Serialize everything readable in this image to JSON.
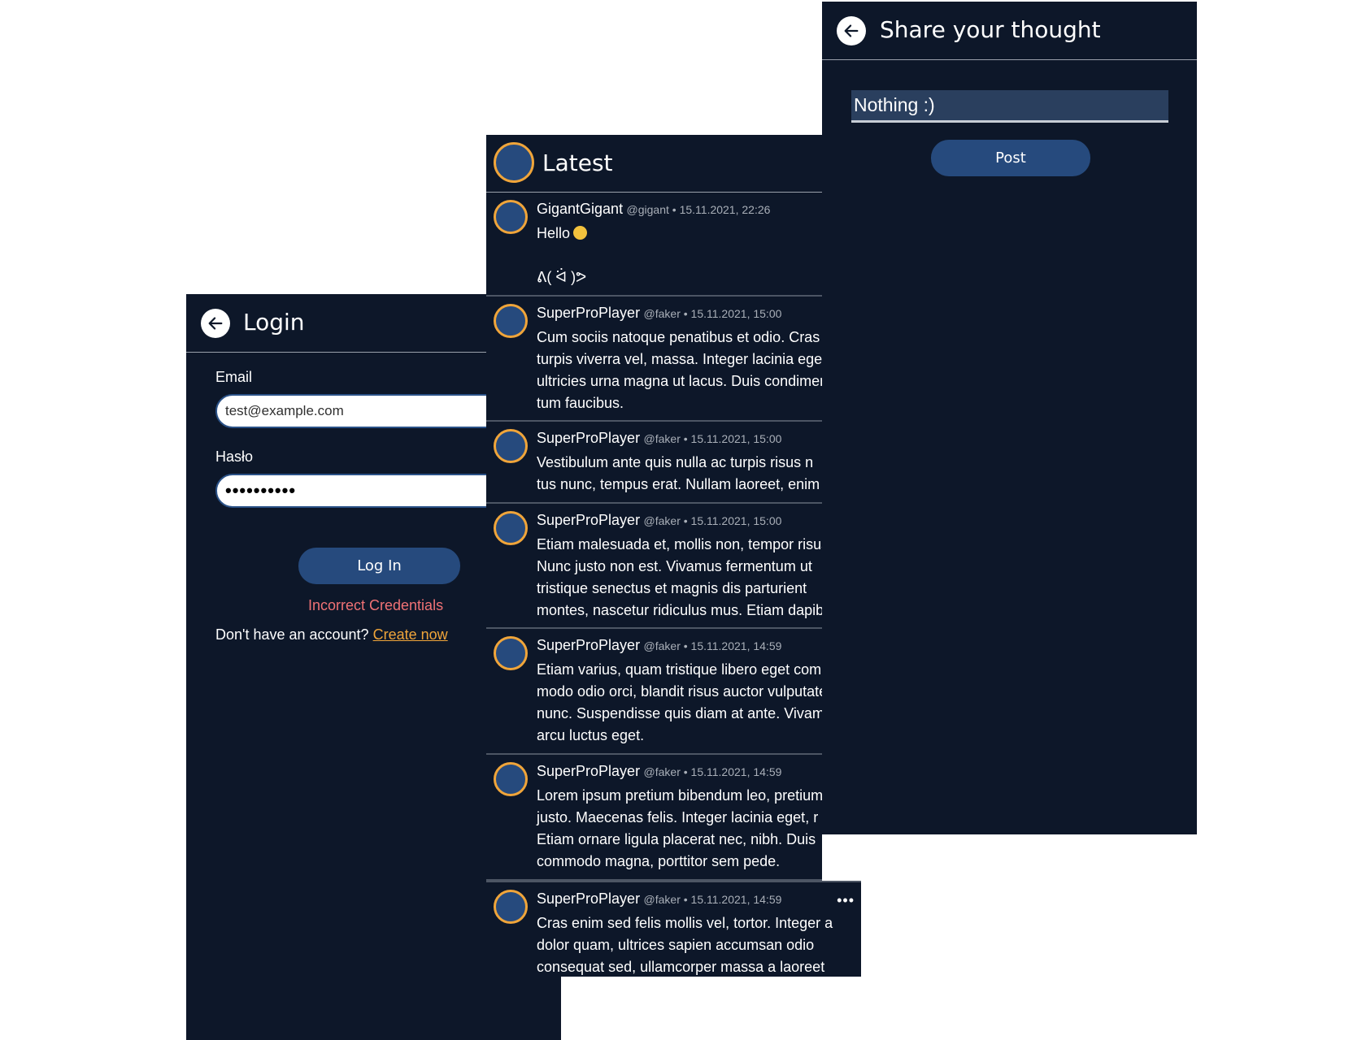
{
  "login": {
    "title": "Login",
    "email_label": "Email",
    "email_value": "test@example.com",
    "password_label": "Hasło",
    "password_value": "••••••••••",
    "login_button": "Log In",
    "error": "Incorrect Credentials",
    "signup_prompt": "Don't have an account?",
    "signup_link": "Create now"
  },
  "feed": {
    "title": "Latest",
    "posts": [
      {
        "name": "GigantGigant",
        "meta": "@gigant • 15.11.2021, 22:26",
        "lines": [
          "Hello",
          "",
          "ᕕ( ᐛ )ᕗ"
        ]
      },
      {
        "name": "SuperProPlayer",
        "meta": "@faker • 15.11.2021, 15:00",
        "lines": [
          "Cum sociis natoque penatibus et odio. Cras",
          "turpis viverra vel, massa. Integer lacinia eget",
          "ultricies urna magna ut lacus. Duis condimen",
          "tum faucibus."
        ]
      },
      {
        "name": "SuperProPlayer",
        "meta": "@faker • 15.11.2021, 15:00",
        "lines": [
          "Vestibulum ante quis nulla ac turpis risus n",
          "tus nunc, tempus erat. Nullam laoreet, enim"
        ]
      },
      {
        "name": "SuperProPlayer",
        "meta": "@faker • 15.11.2021, 15:00",
        "lines": [
          "Etiam malesuada et, mollis non, tempor risus.",
          "Nunc justo non est. Vivamus fermentum ut",
          "tristique senectus et magnis dis parturient",
          "montes, nascetur ridiculus mus. Etiam dapibus"
        ]
      },
      {
        "name": "SuperProPlayer",
        "meta": "@faker • 15.11.2021, 14:59",
        "lines": [
          "Etiam varius, quam tristique libero eget com",
          "modo odio orci, blandit risus auctor vulputate",
          "nunc. Suspendisse quis diam at ante. Vivamus",
          "arcu luctus eget."
        ]
      },
      {
        "name": "SuperProPlayer",
        "meta": "@faker • 15.11.2021, 14:59",
        "lines": [
          "Lorem ipsum pretium bibendum leo, pretium",
          "justo. Maecenas felis. Integer lacinia eget, r",
          "Etiam ornare ligula placerat nec, nibh. Duis",
          "commodo magna, porttitor sem pede."
        ]
      },
      {
        "name": "SuperProPlayer",
        "meta": "@faker • 15.11.2021, 14:59",
        "lines": [
          "Cras enim sed felis mollis vel, tortor. Integer a",
          "dolor quam, ultrices sapien accumsan odio",
          "consequat sed, ullamcorper massa a laoreet"
        ]
      }
    ],
    "more_icon": "•••"
  },
  "share": {
    "title": "Share your thought",
    "input_value": "Nothing :)",
    "post_button": "Post"
  },
  "colors": {
    "panel_bg": "#0d1729",
    "accent": "#f0a53a",
    "button": "#264a7d",
    "error": "#f07275"
  }
}
